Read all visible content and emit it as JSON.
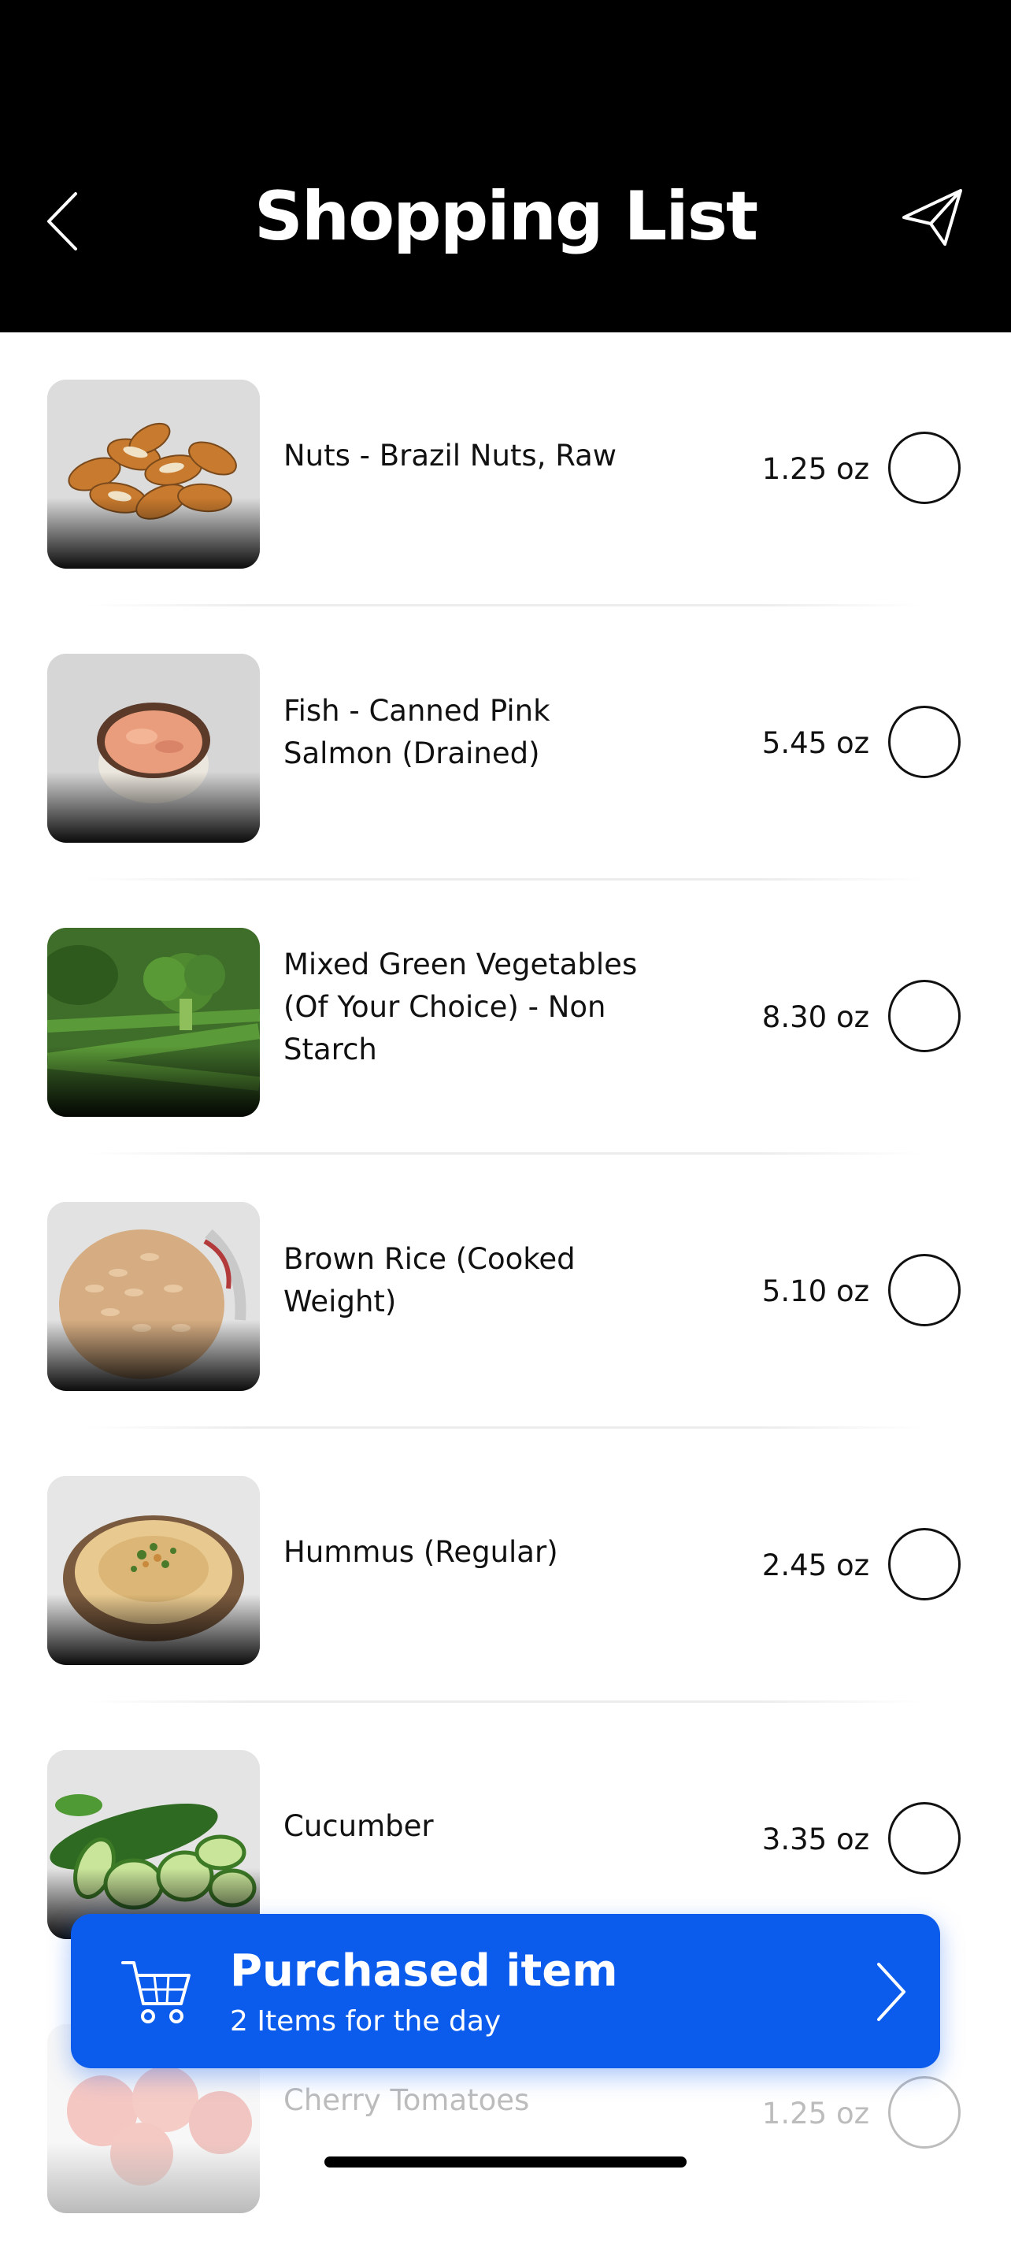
{
  "header": {
    "title": "Shopping List",
    "back_icon": "chevron-left-icon",
    "send_icon": "paper-plane-icon"
  },
  "items": [
    {
      "name": "Nuts - Brazil Nuts, Raw",
      "qty": "1.25 oz",
      "checked": false
    },
    {
      "name": "Fish - Canned Pink Salmon (Drained)",
      "qty": "5.45 oz",
      "checked": false
    },
    {
      "name": "Mixed Green Vegetables (Of Your Choice) - Non Starch",
      "qty": "8.30 oz",
      "checked": false
    },
    {
      "name": "Brown Rice (Cooked Weight)",
      "qty": "5.10 oz",
      "checked": false
    },
    {
      "name": "Hummus (Regular)",
      "qty": "2.45 oz",
      "checked": false
    },
    {
      "name": "Cucumber",
      "qty": "3.35 oz",
      "checked": false
    },
    {
      "name": "Cherry Tomatoes",
      "qty": "1.25 oz",
      "checked": false
    }
  ],
  "purchased_banner": {
    "title": "Purchased item",
    "subtitle": "2 Items for the day",
    "cart_icon": "shopping-cart-icon",
    "chevron_icon": "chevron-right-icon"
  },
  "colors": {
    "header_bg": "#000000",
    "accent": "#0b5ced"
  }
}
